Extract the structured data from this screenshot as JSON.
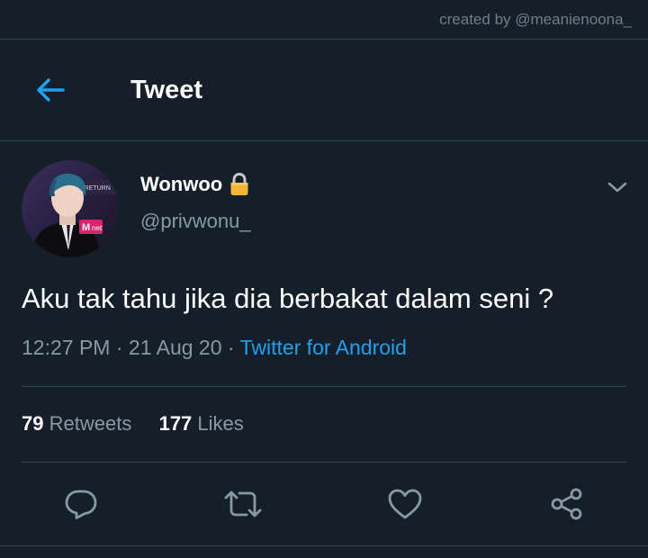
{
  "watermark": "created by @meanienoona_",
  "header": {
    "title": "Tweet",
    "back_icon": "arrow-left-icon"
  },
  "author": {
    "display_name": "Wonwoo",
    "lock_glyph": "🔒",
    "handle": "@privwonu_"
  },
  "tweet": {
    "text": "Aku tak tahu jika dia berbakat dalam seni ?",
    "time": "12:27 PM",
    "separator": "·",
    "date": "21 Aug 20",
    "source": "Twitter for Android"
  },
  "stats": {
    "retweets_count": "79",
    "retweets_label": "Retweets",
    "likes_count": "177",
    "likes_label": "Likes"
  },
  "actions": [
    "reply-icon",
    "retweet-icon",
    "like-icon",
    "share-icon"
  ],
  "colors": {
    "background": "#151f2a",
    "accent": "#1da1f2",
    "secondary_text": "#8899a6",
    "divider": "#38444d"
  }
}
